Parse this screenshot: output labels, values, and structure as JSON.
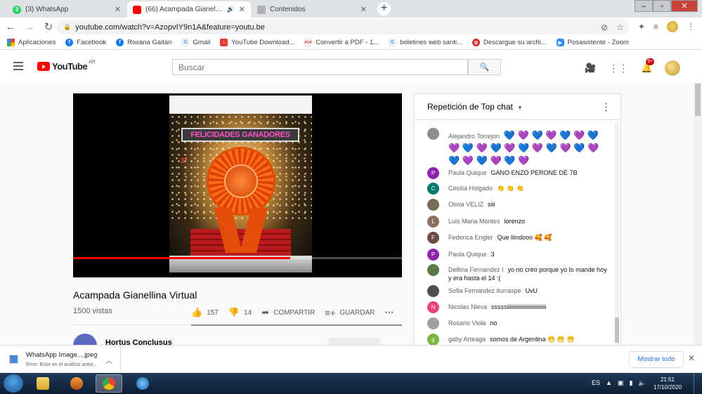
{
  "browser": {
    "tabs": [
      {
        "title": "(3) WhatsApp",
        "favicon_text": "3",
        "favicon_color": "#25d366",
        "active": false
      },
      {
        "title": "(66) Acampada Gianellina Vi",
        "favicon_color": "#ff0000",
        "active": true
      },
      {
        "title": "Contenidos",
        "favicon_color": "#b0b0b0",
        "active": false
      }
    ],
    "url": "youtube.com/watch?v=AzopvIY9n1A&feature=youtu.be",
    "bookmarks": [
      {
        "label": "Aplicaciones",
        "icon": "apps-grid-icon",
        "color": "#4285f4"
      },
      {
        "label": "Facebook",
        "icon": "facebook-icon",
        "color": "#1877f2"
      },
      {
        "label": "Roxana Gaitán",
        "icon": "facebook-icon",
        "color": "#1877f2"
      },
      {
        "label": "Gmail",
        "icon": "google-icon",
        "color": "#ffffff"
      },
      {
        "label": "YouTube Download...",
        "icon": "download-icon",
        "color": "#e53935"
      },
      {
        "label": "Convertir a PDF - 1...",
        "icon": "pdf-icon",
        "color": "#ffffff"
      },
      {
        "label": "boletines web santi...",
        "icon": "google-icon",
        "color": "#ffffff"
      },
      {
        "label": "Descargue su archi...",
        "icon": "no-icon",
        "color": "#d32f2f"
      },
      {
        "label": "Posasistente - Zoom",
        "icon": "zoom-icon",
        "color": "#2d8cff"
      }
    ]
  },
  "youtube": {
    "logo_text": "YouTube",
    "region": "AR",
    "search_placeholder": "Buscar",
    "notification_count": "9+"
  },
  "video": {
    "overlay_banner": "FELICIDADES GANADORES",
    "overlay_place": "2°",
    "progress": 0.66,
    "title": "Acampada Gianellina Virtual",
    "views": "1500 vistas",
    "likes": "157",
    "dislikes": "14",
    "share_label": "COMPARTIR",
    "save_label": "GUARDAR",
    "channel_name": "Hortus Conclusus"
  },
  "chat": {
    "header": "Repetición de Top chat",
    "messages": [
      {
        "author": "Alejandro Torrejon",
        "text": "",
        "hearts": [
          "blue",
          "purple",
          "blue",
          "purple",
          "blue",
          "purple",
          "blue",
          "purple",
          "blue",
          "purple",
          "blue",
          "purple",
          "blue",
          "purple",
          "blue",
          "purple",
          "blue",
          "purple",
          "blue",
          "purple",
          "blue",
          "purple",
          "blue",
          "purple"
        ],
        "avatar_letter": "",
        "avatar_color": "#8d8d8d"
      },
      {
        "author": "Paula Quique",
        "text": "GANO ENZO PERONE DE 7B",
        "avatar_letter": "P",
        "avatar_color": "#8e24aa"
      },
      {
        "author": "Cecilia Holgado",
        "text": "👏 👏 👏",
        "avatar_letter": "C",
        "avatar_color": "#00796b"
      },
      {
        "author": "Olivia VELIZ",
        "text": "siii",
        "avatar_letter": "",
        "avatar_color": "#7a6a5a"
      },
      {
        "author": "Luis Maria Montes",
        "text": "lorenzo",
        "avatar_letter": "L",
        "avatar_color": "#8d6e63"
      },
      {
        "author": "Federica Engler",
        "text": "Que liindooo 🥰 🥰",
        "avatar_letter": "F",
        "avatar_color": "#6d4c41"
      },
      {
        "author": "Paula Quique",
        "text": "3",
        "avatar_letter": "P",
        "avatar_color": "#8e24aa"
      },
      {
        "author": "Delfina Fernandez I",
        "text": "yo no creo porque yo lo mande hoy y era hasta el 14 :(",
        "avatar_letter": "",
        "avatar_color": "#5d7a4a"
      },
      {
        "author": "Sofia Fernandez iturraspe",
        "text": "UvU",
        "avatar_letter": "",
        "avatar_color": "#4e4e4e"
      },
      {
        "author": "Nicolas Nieva",
        "text": "sssssiiiiiiiiiiiiiiiiiiiiiiiiiiii",
        "avatar_letter": "N",
        "avatar_color": "#ec407a"
      },
      {
        "author": "Rosario Viola",
        "text": "no",
        "avatar_letter": "",
        "avatar_color": "#a0a0a0"
      },
      {
        "author": "gaby Arteaga",
        "text": "somos de Argentina 😁 😁 😁",
        "avatar_letter": "g",
        "avatar_color": "#7cb342"
      }
    ]
  },
  "downloads": {
    "file_name": "WhatsApp Image....jpeg",
    "status": "Error: Error en el análisis antivi...",
    "show_all_label": "Mostrar todo"
  },
  "taskbar": {
    "language": "ES",
    "time": "21:51",
    "date": "17/10/2020"
  }
}
